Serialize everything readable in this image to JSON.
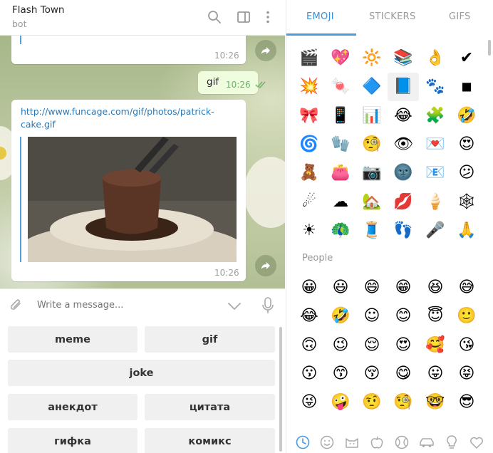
{
  "header": {
    "title": "Flash Town",
    "subtitle": "bot"
  },
  "messages": {
    "m1_time": "10:26",
    "m2_text": "gif",
    "m2_time": "10:26",
    "m3_link": "http://www.funcage.com/gif/photos/patrick-cake.gif",
    "m3_time": "10:26"
  },
  "composer": {
    "placeholder": "Write a message..."
  },
  "keyboard": {
    "buttons": [
      "meme",
      "gif",
      "joke",
      "анекдот",
      "цитата",
      "гифка",
      "комикс"
    ]
  },
  "emoji_panel": {
    "tabs": [
      "EMOJI",
      "STICKERS",
      "GIFS"
    ],
    "active_tab": "EMOJI",
    "recent": [
      "🎬",
      "💖",
      "🔆",
      "📚",
      "👌",
      "✔",
      "💥",
      "🍬",
      "🔷",
      "📘",
      "🐾",
      "◾",
      "🎀",
      "📱",
      "📊",
      "😂",
      "🧩",
      "🤣",
      "🌀",
      "🧤",
      "🧐",
      "👁",
      "💌",
      "😍",
      "🧸",
      "👛",
      "📷",
      "🌚",
      "📧",
      "😕",
      "☄",
      "☁",
      "🏡",
      "💋",
      "🍦",
      "🕸",
      "☀",
      "🦚",
      "🧵",
      "👣",
      "🎤",
      "🙏"
    ],
    "people_label": "People",
    "people": [
      "😀",
      "😃",
      "😄",
      "😁",
      "😆",
      "😅",
      "😂",
      "🤣",
      "☺",
      "😊",
      "😇",
      "🙂",
      "🙃",
      "😉",
      "😌",
      "😍",
      "🥰",
      "😘",
      "😗",
      "😙",
      "😚",
      "😋",
      "😛",
      "😝",
      "😜",
      "🤪",
      "🤨",
      "🧐",
      "🤓",
      "😎"
    ],
    "categories": [
      "recent-icon",
      "smile-icon",
      "cat-icon",
      "apple-icon",
      "ball-icon",
      "car-icon",
      "bulb-icon",
      "heart-icon"
    ]
  },
  "colors": {
    "accent": "#3a8fd6",
    "link": "#2a77b5",
    "outgoing_bubble": "#effdde"
  }
}
